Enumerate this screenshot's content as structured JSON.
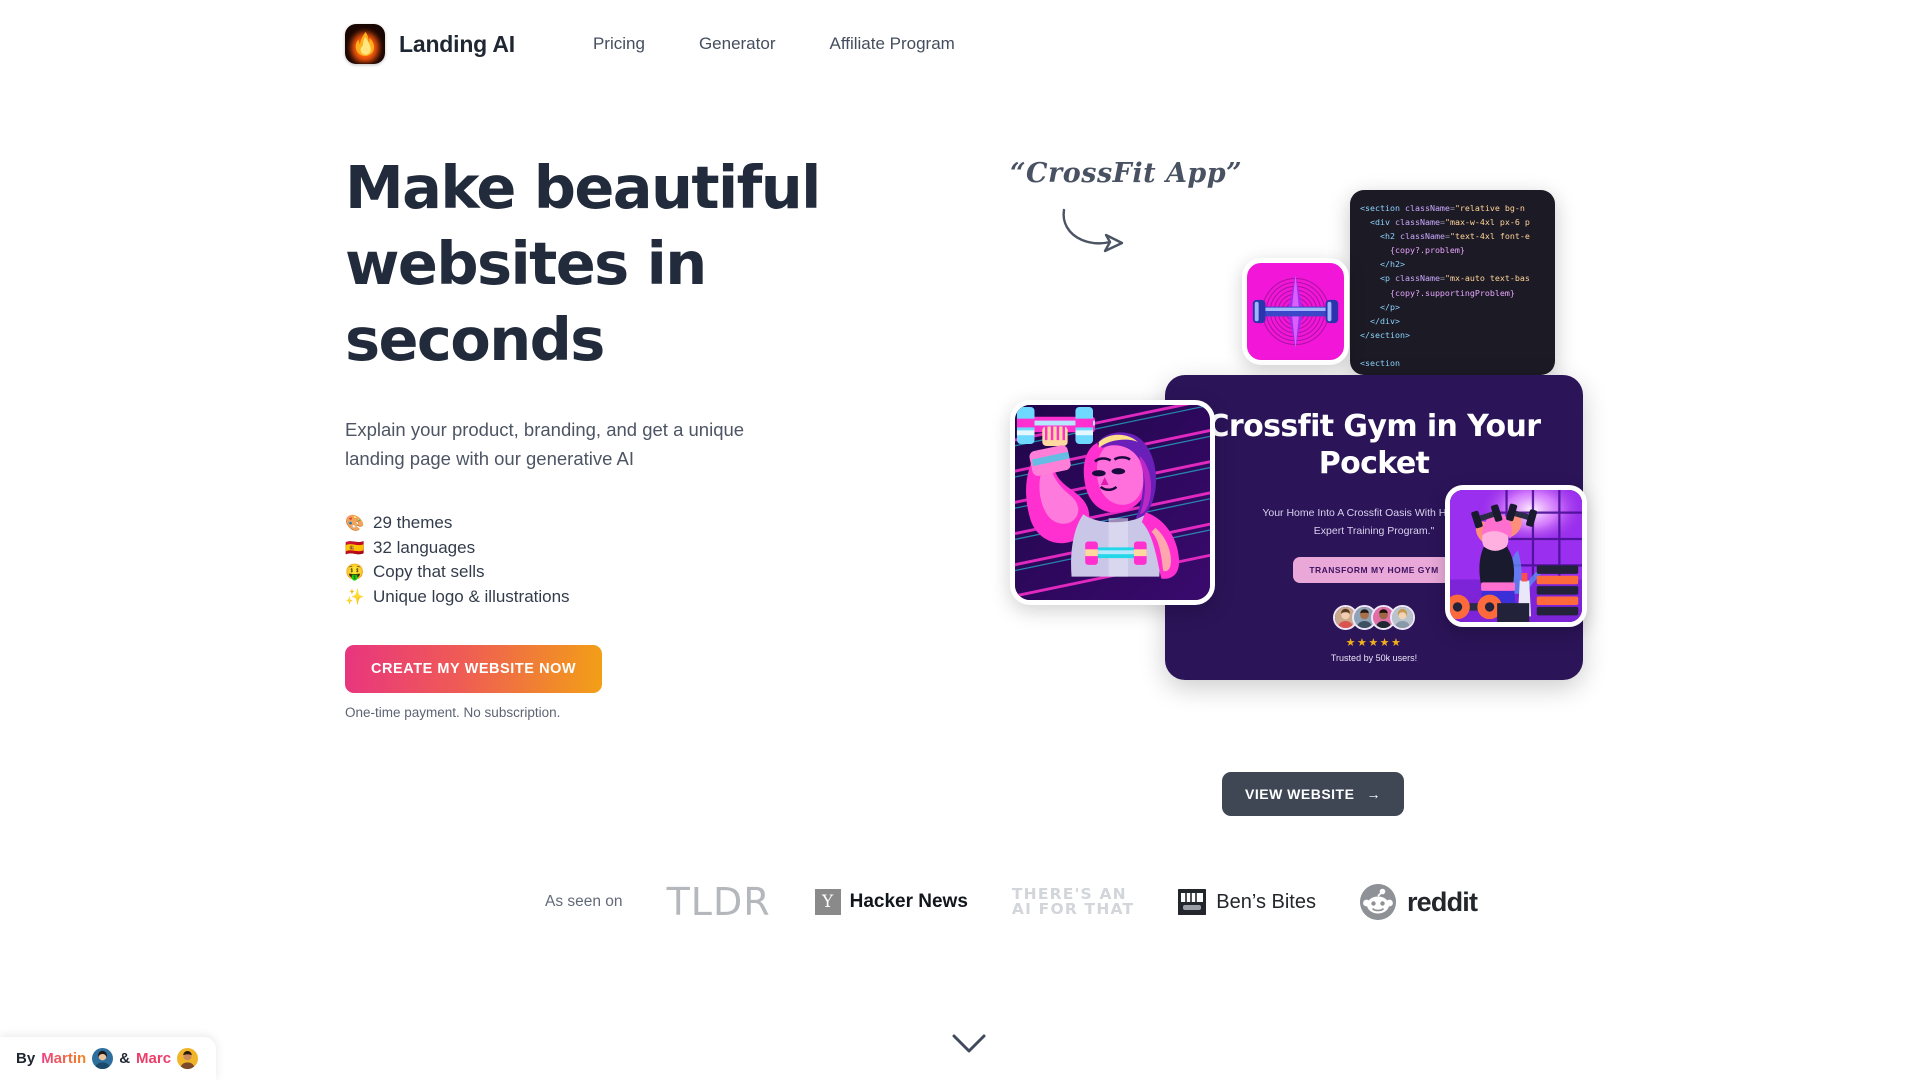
{
  "brand": {
    "name": "Landing AI",
    "logo_icon": "flame-icon"
  },
  "nav": {
    "links": [
      {
        "label": "Pricing"
      },
      {
        "label": "Generator"
      },
      {
        "label": "Affiliate Program"
      }
    ]
  },
  "hero": {
    "headline": "Make beautiful websites in seconds",
    "subhead": "Explain your product, branding, and get a unique landing page with our generative AI",
    "features": [
      {
        "emoji": "🎨",
        "label": "29 themes",
        "icon": "palette-icon"
      },
      {
        "emoji": "🇪🇸",
        "label": "32 languages",
        "icon": "spain-flag-icon"
      },
      {
        "emoji": "🤑",
        "label": "Copy that sells",
        "icon": "money-face-icon"
      },
      {
        "emoji": "✨",
        "label": "Unique logo & illustrations",
        "icon": "sparkles-icon"
      }
    ],
    "cta_label": "CREATE MY WEBSITE NOW",
    "cta_note": "One-time payment. No subscription."
  },
  "annotation": {
    "text": "“CrossFit App”",
    "arrow_icon": "curved-arrow-icon"
  },
  "preview": {
    "code_lines": [
      "<section className=\"relative bg-n",
      "  <div className=\"max-w-4xl px-6 p",
      "    <h2 className=\"text-4xl font-e",
      "      {copy?.problem}",
      "    </h2>",
      "    <p className=\"mx-auto text-bas",
      "      {copy?.supportingProblem}",
      "    </p>",
      "  </div>",
      "</section>",
      "",
      "<section"
    ],
    "landing_page": {
      "title": "Crossfit Gym in Your Pocket",
      "subtitle": "Your Home Into A Crossfit Oasis With HomeFit's Expert Training Program.\"",
      "button_label": "TRANSFORM MY HOME GYM",
      "stars": "★★★★★",
      "trust_text": "Trusted by 50k users!",
      "avatar_count": 4,
      "bg_color": "#2b1458",
      "button_color": "#e9a8d8"
    },
    "logo_tile": {
      "icon": "barbell-logo-icon",
      "bg_color": "#f216d8"
    },
    "illustration_1": {
      "icon": "bodybuilder-illustration"
    },
    "illustration_2": {
      "icon": "woman-lifting-illustration"
    },
    "view_button_label": "VIEW WEBSITE",
    "view_button_arrow": "→"
  },
  "as_seen_on": {
    "label": "As seen on",
    "logos": [
      {
        "name": "TLDR",
        "icon": "tldr-logo"
      },
      {
        "name": "Hacker News",
        "badge": "Y",
        "icon": "hacker-news-logo"
      },
      {
        "name": "THERE'S AN\nAI FOR THAT",
        "icon": "theres-an-ai-for-that-logo"
      },
      {
        "name": "Ben’s Bites",
        "icon": "bens-bites-logo"
      },
      {
        "name": "reddit",
        "icon": "reddit-logo"
      }
    ]
  },
  "scroll_hint": {
    "icon": "chevron-down-icon"
  },
  "credits": {
    "by": "By",
    "name_1": "Martin",
    "amp": "&",
    "name_2": "Marc"
  }
}
